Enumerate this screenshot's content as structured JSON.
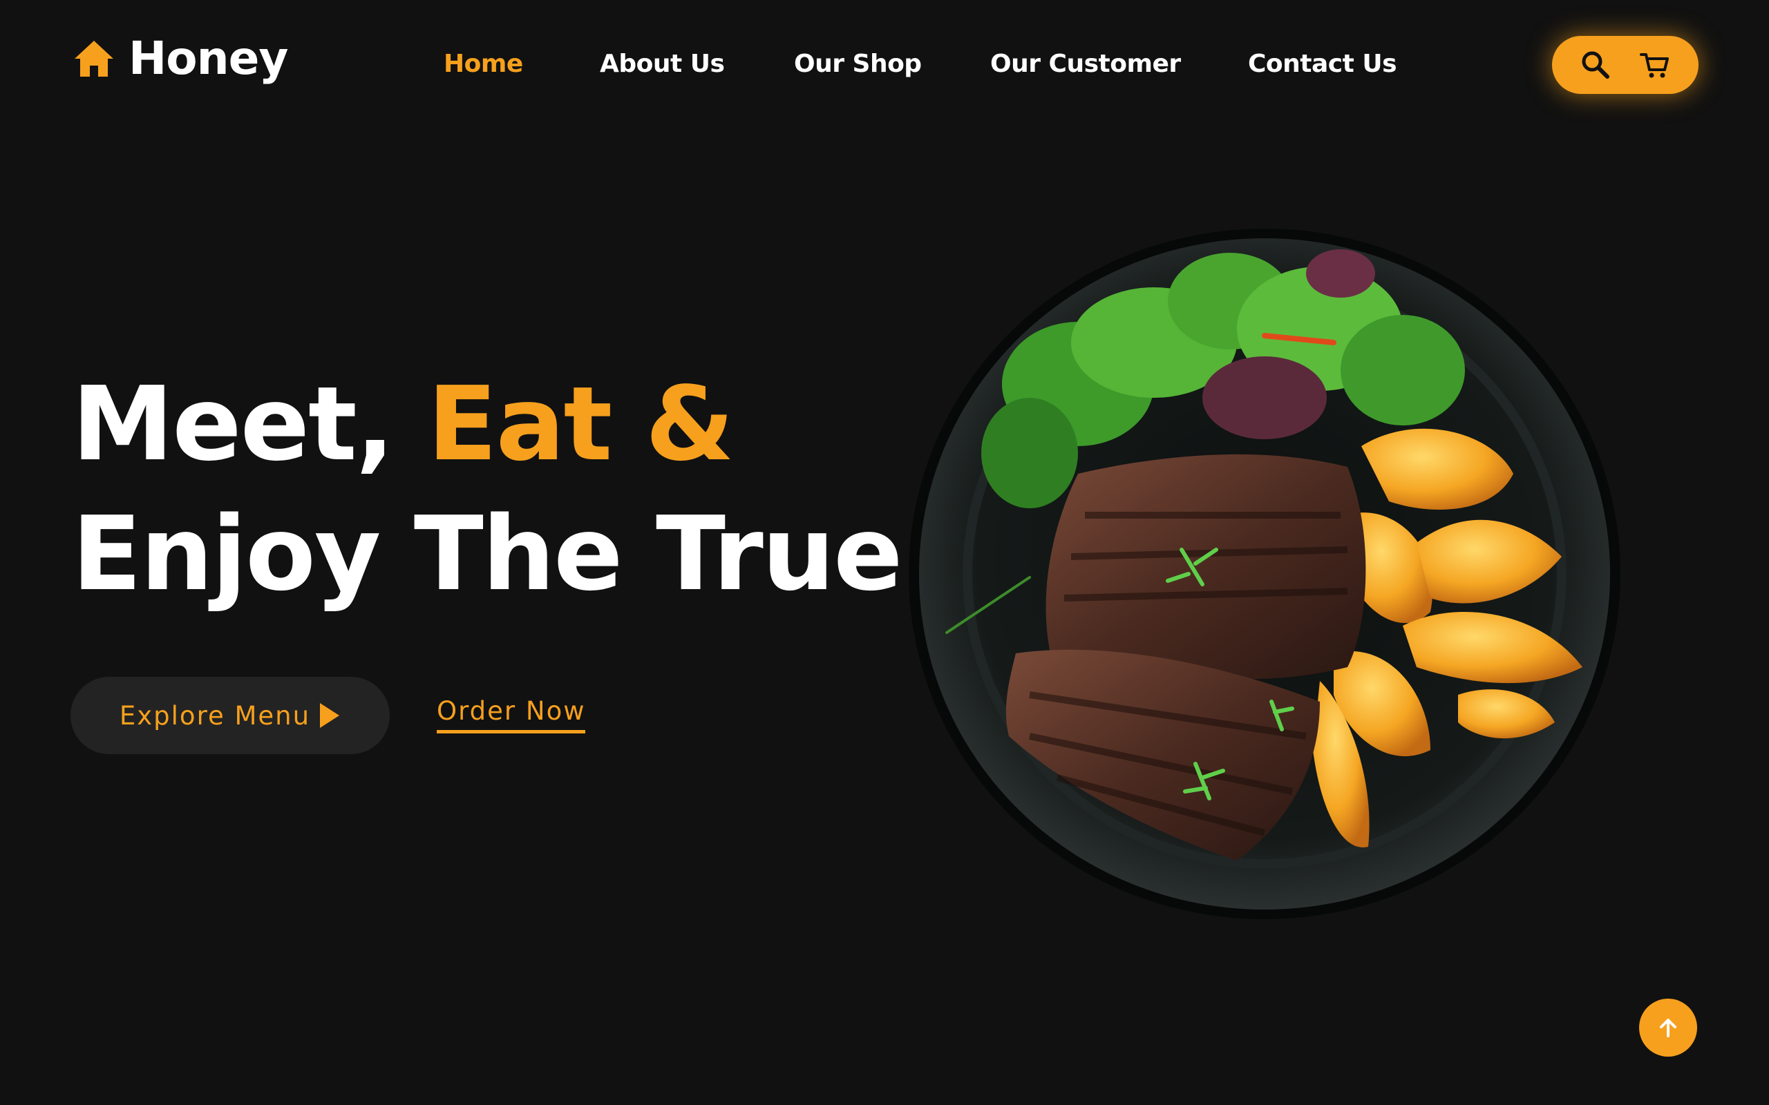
{
  "brand": {
    "name": "Honey",
    "icon": "home-icon"
  },
  "nav": {
    "items": [
      {
        "label": "Home",
        "active": true
      },
      {
        "label": "About Us",
        "active": false
      },
      {
        "label": "Our Shop",
        "active": false
      },
      {
        "label": "Our Customer",
        "active": false
      },
      {
        "label": "Contact Us",
        "active": false
      }
    ]
  },
  "actions": {
    "search_icon": "search-icon",
    "cart_icon": "cart-icon"
  },
  "hero": {
    "line1_white": "Meet, ",
    "line1_accent": "Eat &",
    "line2": "Enjoy The True",
    "explore_label": "Explore Menu",
    "order_label": "Order Now"
  },
  "image": {
    "subject": "steak-plate-image"
  },
  "scroll_top_icon": "arrow-up-icon",
  "colors": {
    "accent": "#F7A01D",
    "background": "#111111",
    "button_dark": "#232323",
    "text": "#FFFFFF"
  }
}
